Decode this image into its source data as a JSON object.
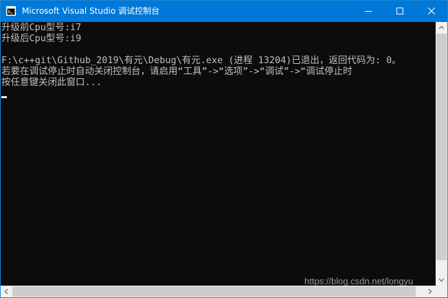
{
  "window": {
    "title": "Microsoft Visual Studio 调试控制台",
    "icon": "console-app-icon",
    "buttons": {
      "minimize_icon": "minimize-icon",
      "maximize_icon": "maximize-icon",
      "close_icon": "close-icon"
    }
  },
  "console": {
    "lines": [
      "升级前Cpu型号:i7",
      "升级后Cpu型号:i9",
      "",
      "F:\\c++git\\Github_2019\\有元\\Debug\\有元.exe (进程 13204)已退出，返回代码为: 0。",
      "若要在调试停止时自动关闭控制台，请启用“工具”->“选项”->“调试”->“调试停止时",
      "按任意键关闭此窗口..."
    ],
    "watermark": "https://blog.csdn.net/longyu"
  },
  "colors": {
    "titlebar": "#0078d7",
    "console_bg": "#0c0c0c",
    "console_text": "#c0c0c0"
  }
}
